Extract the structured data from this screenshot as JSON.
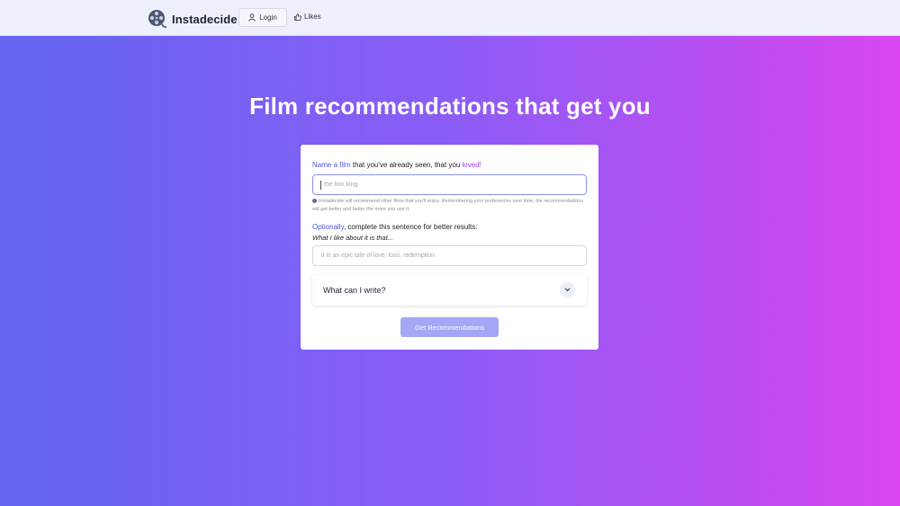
{
  "header": {
    "brand": "Instadecide",
    "login_label": "Login",
    "likes_label": "Likes"
  },
  "hero": {
    "title": "Film recommendations that get you"
  },
  "form": {
    "q1": {
      "highlight": "Name a film",
      "middle": " that you've already seen, that you ",
      "emphasis": "loved!"
    },
    "film_input": {
      "placeholder": "the lion king"
    },
    "hint": "Instadecide will recommend other films that you'll enjoy. Remembering your preferences over time, the recommendations will get better and better the more you use it.",
    "q2": {
      "highlight": "Optionally",
      "rest": ", complete this sentence for better results:"
    },
    "q2_sub": "What I like about it is that...",
    "like_input": {
      "placeholder": "it is an epic tale of love, loss, redemption"
    },
    "accordion_label": "What can I write?",
    "submit_label": "Get Recommendations"
  },
  "colors": {
    "gradient_start": "#6366f1",
    "gradient_end": "#d946ef",
    "accent_blue": "#4f57d8",
    "accent_purple": "#a23ef0",
    "button": "#a5a6f5"
  },
  "icons": {
    "brand": "film-reel-icon",
    "login": "user-icon",
    "likes": "thumbs-up-icon",
    "accordion": "chevron-down-icon",
    "hint": "info-dot-icon"
  }
}
